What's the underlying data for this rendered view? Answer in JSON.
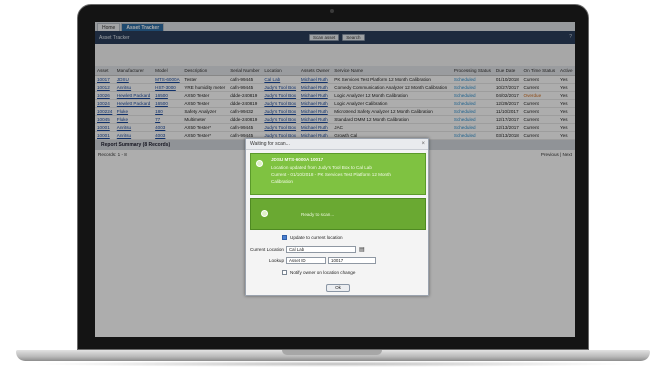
{
  "tabs": [
    {
      "label": "Home",
      "active": false
    },
    {
      "label": "Asset Tracker",
      "active": true
    }
  ],
  "titlebar": {
    "title": "Asset Tracker",
    "scan_label": "Scan asset",
    "search_label": "Search"
  },
  "table": {
    "columns": [
      "Asset",
      "Manufacturer",
      "Model",
      "Description",
      "Serial Number",
      "Location",
      "Assets Owner",
      "Service Name",
      "Processing Status",
      "Due Date",
      "On Time Status",
      "Active"
    ],
    "rows": [
      [
        "10017",
        "JDSU",
        "MTS-6000A",
        "Tester",
        "cafn-99445",
        "Cal Lab",
        "Michael Ruth",
        "PK Services Test Platform 12 Month Calibration",
        "Scheduled",
        "01/10/2018",
        "Current",
        "Yes"
      ],
      [
        "10012",
        "Anritsu",
        "HST-3000",
        "YRE humidity meter",
        "cafn-99445",
        "Judy's Tool Box",
        "Michael Ruth",
        "Comedy Communication Analyzer 12 Month Calibration",
        "Scheduled",
        "10/27/2017",
        "Current",
        "Yes"
      ],
      [
        "10026",
        "Hewlett Packard",
        "16500",
        "AX50 Tester",
        "ddde-240819",
        "Judy's Tool Box",
        "Michael Ruth",
        "Logic Analyzer 12 Month Calibration",
        "Scheduled",
        "04/02/2017",
        "Overdue",
        "Yes"
      ],
      [
        "10024",
        "Hewlett Packard",
        "16500",
        "AX50 Tester",
        "ddde-240819",
        "Judy's Tool Box",
        "Michael Ruth",
        "Logic Analyzer Calibration",
        "Scheduled",
        "12/29/2017",
        "Current",
        "Yes"
      ],
      [
        "100224",
        "Fluke",
        "180",
        "Safety Analyzer",
        "cafn-99432",
        "Judy's Tool Box",
        "Michael Ruth",
        "Microtrend Safety Analyzer 12 Month Calibration",
        "Scheduled",
        "11/10/2017",
        "Current",
        "Yes"
      ],
      [
        "10045",
        "Fluke",
        "77",
        "Multimeter",
        "ddde-240819",
        "Judy's Tool Box",
        "Michael Ruth",
        "Standard DMM 12 Month Calibration",
        "Scheduled",
        "12/17/2017",
        "Current",
        "Yes"
      ],
      [
        "10001",
        "Anritsu",
        "4003",
        "AX50 Tester*",
        "cafn-99445",
        "Judy's Tool Box",
        "Michael Ruth",
        "JAC",
        "Scheduled",
        "12/13/2017",
        "Current",
        "Yes"
      ],
      [
        "10001",
        "Anritsu",
        "4003",
        "AX50 Tester*",
        "cafn-99445",
        "Judy's Tool Box",
        "Michael Ruth",
        "Growth Cal",
        "Scheduled",
        "03/13/2018",
        "Current",
        "Yes"
      ]
    ]
  },
  "summary": {
    "label": "Report Summary (8 Records)"
  },
  "footer": {
    "records": "Records: 1 - 8",
    "pager": "Previous | Next"
  },
  "dialog": {
    "title": "Waiting for scan...",
    "close_glyph": "×",
    "result": {
      "line1": "JDSU MTS-6000A 10017",
      "line2": "Location updated from Judy's Tool Box to Cal Lab",
      "line3": "Current - 01/10/2018 - PK Services Test Platform 12 Month",
      "line4": "Calibration"
    },
    "ready_text": "Ready to scan...",
    "update_label": "Update to current location",
    "update_checked": true,
    "current_location_label": "Current Location",
    "current_location_value": "Cal Lab",
    "lookup_label": "Lookup",
    "lookup_type": "Asset ID",
    "lookup_value": "10017",
    "notify_label": "Notify owner on location change",
    "notify_checked": false,
    "ok_label": "Ok"
  },
  "colors": {
    "accent": "#2e6da4",
    "header": "#2b3f5c",
    "success": "#7fc241",
    "overdue": "#d06b1a"
  }
}
